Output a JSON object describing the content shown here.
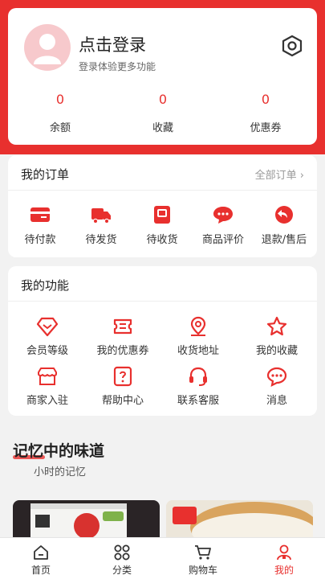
{
  "theme": {
    "accent": "#e8302e",
    "avatar_bg": "#f7c9cc"
  },
  "profile": {
    "login_title": "点击登录",
    "login_subtitle": "登录体验更多功能",
    "settings_icon": "settings-icon",
    "stats": [
      {
        "value": "0",
        "label": "余额"
      },
      {
        "value": "0",
        "label": "收藏"
      },
      {
        "value": "0",
        "label": "优惠券"
      }
    ]
  },
  "orders": {
    "title": "我的订单",
    "all_label": "全部订单 ›",
    "items": [
      {
        "label": "待付款",
        "icon": "wallet-icon"
      },
      {
        "label": "待发货",
        "icon": "truck-icon"
      },
      {
        "label": "待收货",
        "icon": "package-icon"
      },
      {
        "label": "商品评价",
        "icon": "comment-icon"
      },
      {
        "label": "退款/售后",
        "icon": "refund-icon"
      }
    ]
  },
  "functions": {
    "title": "我的功能",
    "items": [
      {
        "label": "会员等级",
        "icon": "diamond-icon"
      },
      {
        "label": "我的优惠券",
        "icon": "ticket-icon"
      },
      {
        "label": "收货地址",
        "icon": "location-icon"
      },
      {
        "label": "我的收藏",
        "icon": "star-icon"
      },
      {
        "label": "商家入驻",
        "icon": "store-icon"
      },
      {
        "label": "帮助中心",
        "icon": "help-icon"
      },
      {
        "label": "联系客服",
        "icon": "headset-icon"
      },
      {
        "label": "消息",
        "icon": "message-icon"
      }
    ]
  },
  "memory": {
    "title": "记忆中的味道",
    "subtitle": "小时的记忆"
  },
  "tabbar": {
    "items": [
      {
        "label": "首页",
        "icon": "home-icon"
      },
      {
        "label": "分类",
        "icon": "category-icon"
      },
      {
        "label": "购物车",
        "icon": "cart-icon"
      },
      {
        "label": "我的",
        "icon": "user-icon",
        "active": true
      }
    ]
  }
}
